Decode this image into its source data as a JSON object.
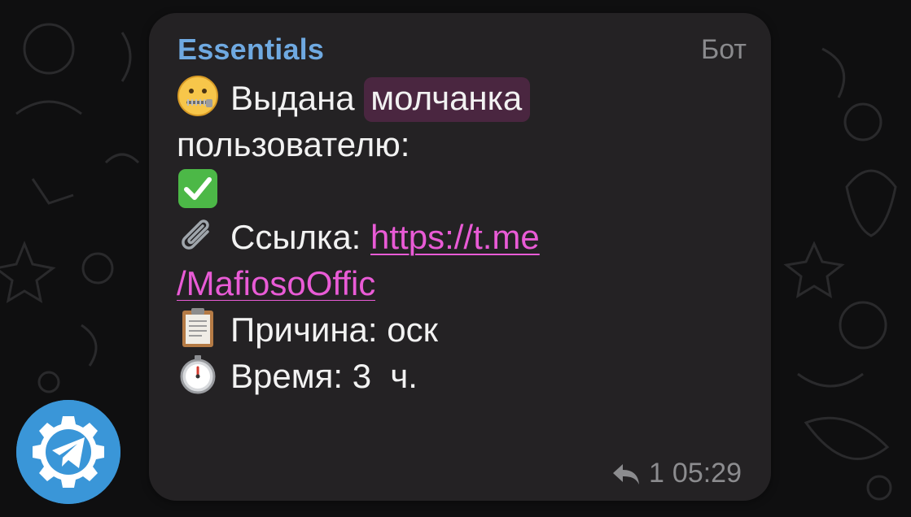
{
  "message": {
    "sender": "Essentials",
    "badge": "Бот",
    "lines": {
      "muted_prefix": "Выдана",
      "muted_word": "молчанка",
      "user_label": "пользователю:",
      "link_label": "Ссылка:",
      "link_part1": "https://t.me",
      "link_part2": "/MafiosoOffic",
      "reason_label": "Причина:",
      "reason_value": "оск",
      "time_label": "Время:",
      "time_value": "3  ч."
    },
    "reply_count": "1",
    "time": "05:29"
  },
  "icons": {
    "mute": "zipper-mouth-face-icon",
    "check": "check-mark-button-icon",
    "link": "paperclip-icon",
    "reason": "clipboard-icon",
    "time": "stopwatch-icon",
    "reply": "reply-arrow-icon",
    "fab": "telegram-gear-icon"
  },
  "colors": {
    "sender": "#6fa9e1",
    "link": "#e95bd6",
    "spoiler_bg": "#4a2640",
    "fab": "#3a96d8"
  }
}
